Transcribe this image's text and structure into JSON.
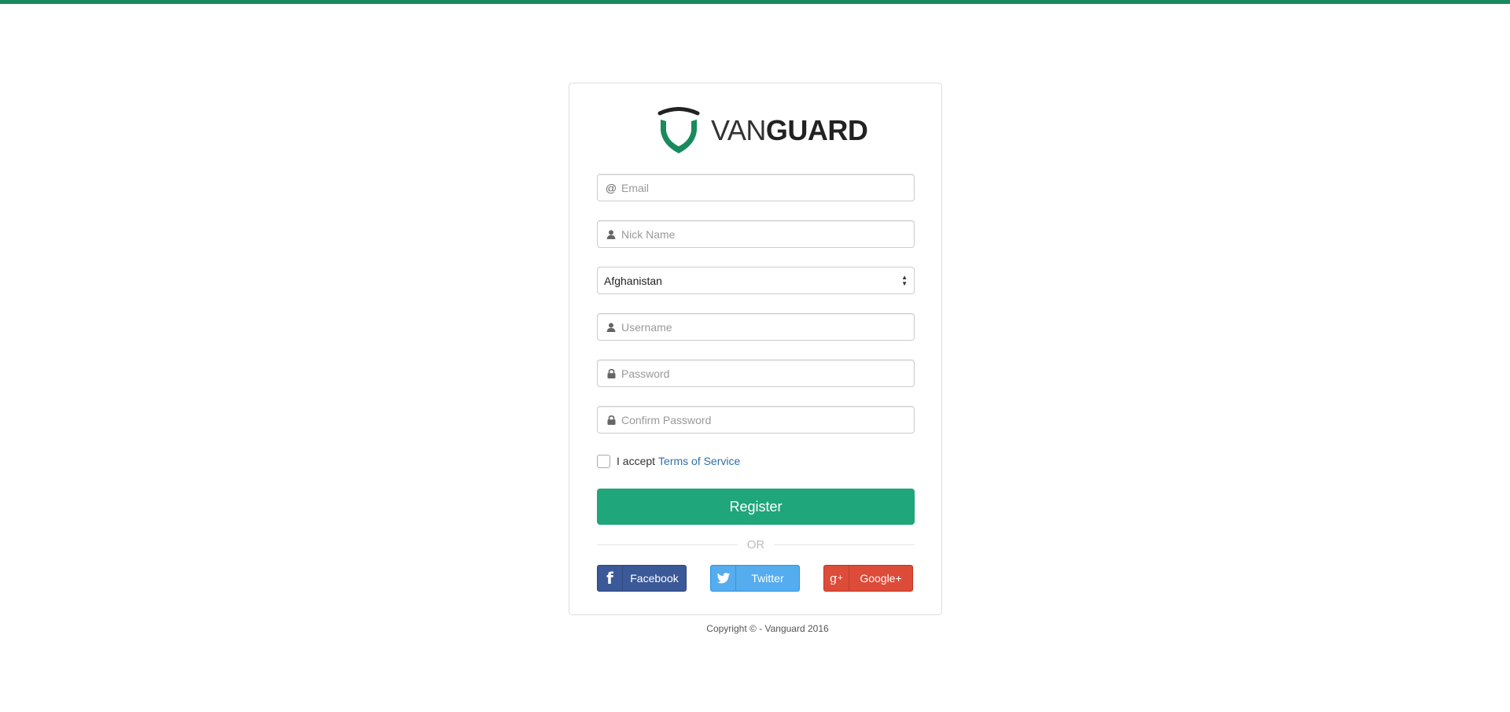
{
  "brand": {
    "name_light": "VAN",
    "name_bold": "GUARD",
    "accent_color": "#1a8a5e",
    "button_color": "#1fa67a"
  },
  "form": {
    "email": {
      "placeholder": "Email",
      "icon": "at-icon",
      "value": ""
    },
    "nickname": {
      "placeholder": "Nick Name",
      "icon": "user-icon",
      "value": ""
    },
    "country": {
      "selected": "Afghanistan"
    },
    "username": {
      "placeholder": "Username",
      "icon": "user-icon",
      "value": ""
    },
    "password": {
      "placeholder": "Password",
      "icon": "lock-icon",
      "value": ""
    },
    "confirm_password": {
      "placeholder": "Confirm Password",
      "icon": "lock-icon",
      "value": ""
    },
    "terms": {
      "prefix": "I accept",
      "link": "Terms of Service",
      "checked": false
    },
    "register_label": "Register",
    "or_label": "OR"
  },
  "social": {
    "facebook": {
      "label": "Facebook",
      "color": "#3b5998"
    },
    "twitter": {
      "label": "Twitter",
      "color": "#55acee"
    },
    "google": {
      "label": "Google+",
      "color": "#dd4b39"
    }
  },
  "footer": {
    "copyright": "Copyright © - Vanguard 2016"
  }
}
